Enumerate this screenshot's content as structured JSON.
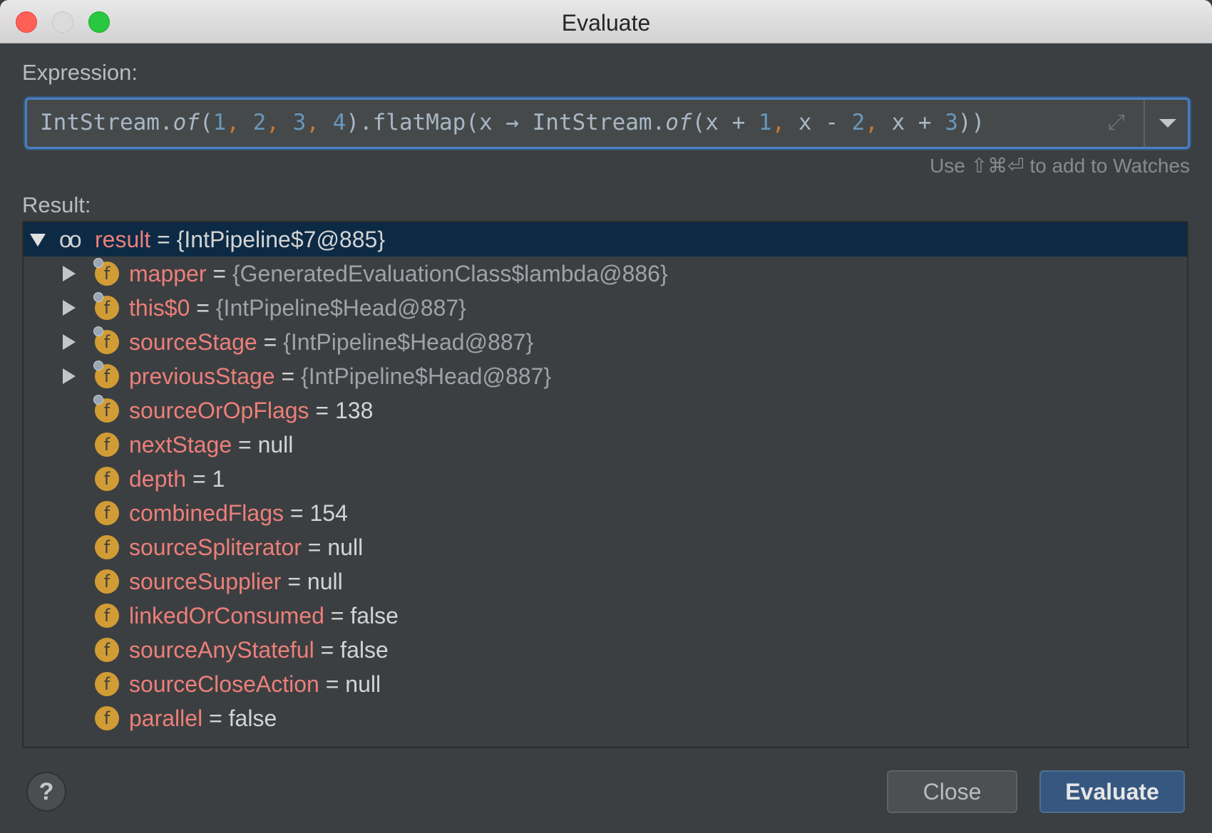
{
  "window": {
    "title": "Evaluate"
  },
  "expression": {
    "label": "Expression:",
    "tokens": {
      "t1": "IntStream.",
      "t2": "of",
      "t3": "(",
      "n1": "1",
      "c1": ", ",
      "n2": "2",
      "c2": ", ",
      "n3": "3",
      "c3": ", ",
      "n4": "4",
      "t4": ").flatMap(x → IntStream.",
      "t5": "of",
      "t6": "(x + ",
      "n5": "1",
      "c4": ", ",
      "t7": "x - ",
      "n6": "2",
      "c5": ", ",
      "t8": "x + ",
      "n7": "3",
      "t9": "))"
    },
    "hint": "Use ⇧⌘⏎ to add to Watches",
    "expand_icon": "expand-icon",
    "history_icon": "chevron-down-icon"
  },
  "result": {
    "label": "Result:",
    "root": {
      "name": "result",
      "eq": " = ",
      "value": "{IntPipeline$7@885}"
    },
    "fields": [
      {
        "name": "mapper",
        "eq": " = ",
        "value": "{GeneratedEvaluationClass$lambda@886}"
      },
      {
        "name": "this$0",
        "eq": " = ",
        "value": "{IntPipeline$Head@887}"
      },
      {
        "name": "sourceStage",
        "eq": " = ",
        "value": "{IntPipeline$Head@887}"
      },
      {
        "name": "previousStage",
        "eq": " = ",
        "value": "{IntPipeline$Head@887}"
      },
      {
        "name": "sourceOrOpFlags",
        "eq": " = ",
        "value": "138"
      },
      {
        "name": "nextStage",
        "eq": " = ",
        "value": "null"
      },
      {
        "name": "depth",
        "eq": " = ",
        "value": "1"
      },
      {
        "name": "combinedFlags",
        "eq": " = ",
        "value": "154"
      },
      {
        "name": "sourceSpliterator",
        "eq": " = ",
        "value": "null"
      },
      {
        "name": "sourceSupplier",
        "eq": " = ",
        "value": "null"
      },
      {
        "name": "linkedOrConsumed",
        "eq": " = ",
        "value": "false"
      },
      {
        "name": "sourceAnyStateful",
        "eq": " = ",
        "value": "false"
      },
      {
        "name": "sourceCloseAction",
        "eq": " = ",
        "value": "null"
      },
      {
        "name": "parallel",
        "eq": " = ",
        "value": "false"
      }
    ],
    "field_icon_letter": "f",
    "watch_icon": "oo"
  },
  "buttons": {
    "help": "?",
    "close": "Close",
    "evaluate": "Evaluate"
  },
  "colors": {
    "accent": "#4b7fc3",
    "selection": "#0d2a45",
    "field_name": "#ec7f7a",
    "field_icon": "#d19c35",
    "primary_button": "#365880"
  }
}
